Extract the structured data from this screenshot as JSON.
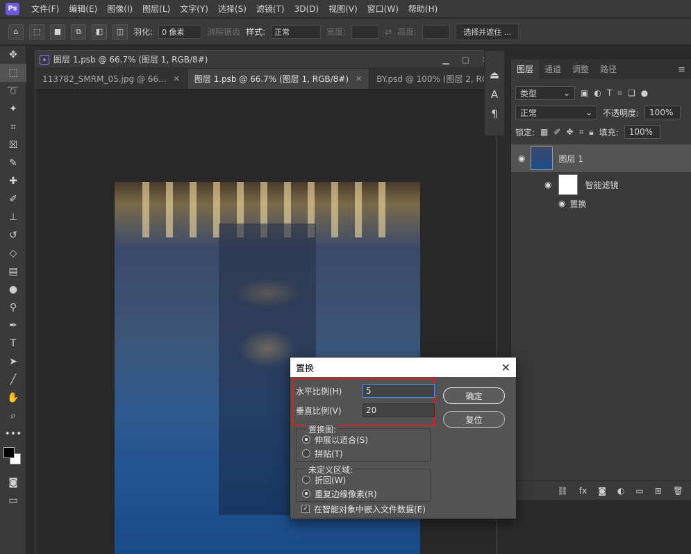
{
  "menubar": {
    "logo": "Ps",
    "items": [
      "文件(F)",
      "编辑(E)",
      "图像(I)",
      "图层(L)",
      "文字(Y)",
      "选择(S)",
      "滤镜(T)",
      "3D(D)",
      "视图(V)",
      "窗口(W)",
      "帮助(H)"
    ]
  },
  "options": {
    "feather_label": "羽化:",
    "feather_value": "0 像素",
    "antialias_label": "消除锯齿",
    "style_label": "样式:",
    "style_value": "正常",
    "width_label": "宽度:",
    "height_label": "高度:",
    "select_mask_label": "选择并遮住 ..."
  },
  "document": {
    "title": "图层 1.psb @ 66.7% (图层 1, RGB/8#)",
    "tabs": [
      {
        "label": "113782_SMRM_05.jpg @ 66..."
      },
      {
        "label": "图层 1.psb @ 66.7% (图层 1, RGB/8#)"
      },
      {
        "label": "BY.psd @ 100% (图层 2, RG..."
      }
    ]
  },
  "layers_panel": {
    "tabs": [
      "图层",
      "通道",
      "调整",
      "路径"
    ],
    "filter_kind": "类型",
    "blend_mode": "正常",
    "opacity_label": "不透明度:",
    "opacity_value": "100%",
    "lock_label": "锁定:",
    "fill_label": "填充:",
    "fill_value": "100%",
    "layer_name": "图层 1",
    "smart_filters_label": "智能滤镜",
    "filter_name": "置换"
  },
  "dialog": {
    "title": "置换",
    "horizontal_label": "水平比例(H)",
    "horizontal_value": "5",
    "vertical_label": "垂直比例(V)",
    "vertical_value": "20",
    "ok_label": "确定",
    "reset_label": "复位",
    "map_group_label": "置换图:",
    "map_options": [
      "伸展以适合(S)",
      "拼贴(T)"
    ],
    "map_selected": 0,
    "undefined_group_label": "未定义区域:",
    "undefined_options": [
      "折回(W)",
      "重复边缘像素(R)"
    ],
    "undefined_selected": 1,
    "embed_label": "在智能对象中嵌入文件数据(E)",
    "embed_checked": true
  },
  "colors": {
    "accent": "#4a8ff7",
    "highlight": "#e02020"
  }
}
